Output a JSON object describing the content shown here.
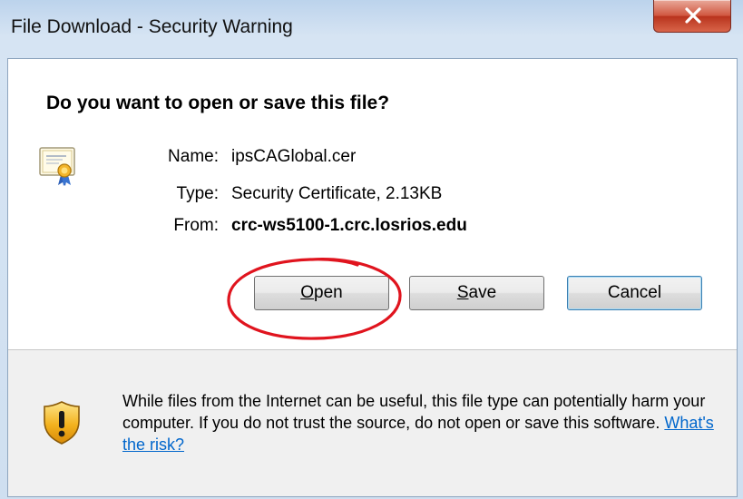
{
  "window": {
    "title": "File Download - Security Warning",
    "close_label": "x"
  },
  "dialog": {
    "heading": "Do you want to open or save this file?",
    "fields": {
      "name_label": "Name:",
      "name_value": "ipsCAGlobal.cer",
      "type_label": "Type:",
      "type_value": "Security Certificate, 2.13KB",
      "from_label": "From:",
      "from_value": "crc-ws5100-1.crc.losrios.edu"
    },
    "buttons": {
      "open": {
        "access_key": "O",
        "rest": "pen"
      },
      "save": {
        "access_key": "S",
        "rest": "ave"
      },
      "cancel": "Cancel"
    }
  },
  "warning": {
    "text": "While files from the Internet can be useful, this file type can potentially harm your computer. If you do not trust the source, do not open or save this software.",
    "link_text": "What's the risk?"
  },
  "colors": {
    "annotation_ring": "#e0141e",
    "link": "#0066cc",
    "close_button": "#c94a32"
  }
}
